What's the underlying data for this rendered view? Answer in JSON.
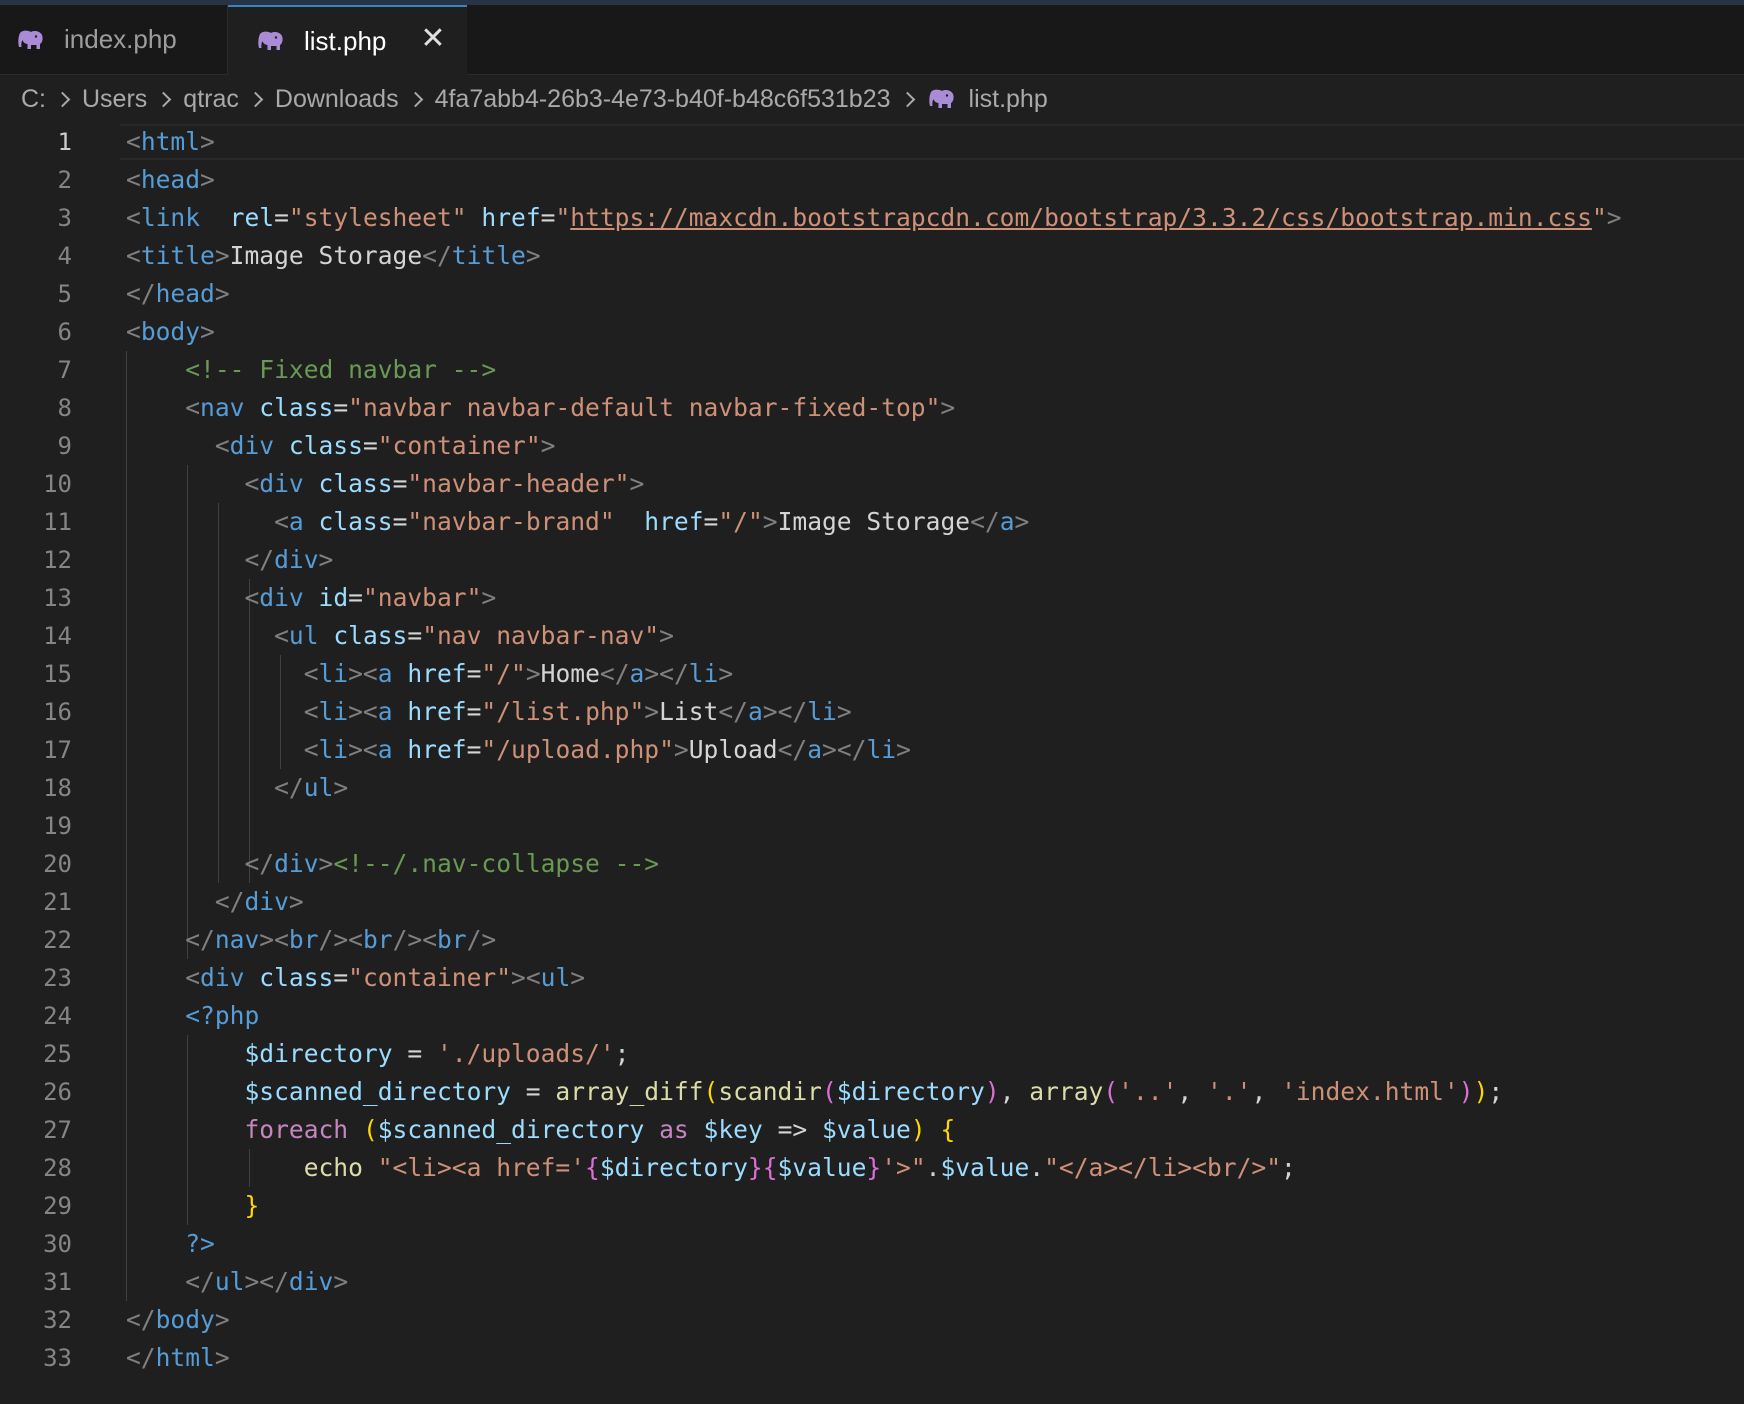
{
  "tabs": [
    {
      "label": "index.php",
      "icon": "php-elephant-icon"
    },
    {
      "label": "list.php",
      "icon": "php-elephant-icon",
      "close": "✕"
    }
  ],
  "breadcrumb": [
    "C:",
    "Users",
    "qtrac",
    "Downloads",
    "4fa7abb4-26b3-4e73-b40f-b48c6f531b23",
    "list.php"
  ],
  "active_line": 1,
  "colors": {
    "tag": "#569cd6",
    "attr": "#9cdcfe",
    "string": "#ce9178",
    "comment": "#6a9955",
    "function": "#dcdcaa",
    "keyword": "#c586c0",
    "php_icon": "#a98bd6"
  },
  "lines": [
    [
      [
        "p",
        "<"
      ],
      [
        "tg",
        "html"
      ],
      [
        "p",
        ">"
      ]
    ],
    [
      [
        "p",
        "<"
      ],
      [
        "tg",
        "head"
      ],
      [
        "p",
        ">"
      ]
    ],
    [
      [
        "p",
        "<"
      ],
      [
        "tg",
        "link"
      ],
      [
        "",
        "  "
      ],
      [
        "at",
        "rel"
      ],
      [
        "",
        "="
      ],
      [
        "s",
        "\"stylesheet\""
      ],
      [
        "",
        " "
      ],
      [
        "at",
        "href"
      ],
      [
        "",
        "="
      ],
      [
        "s",
        "\""
      ],
      [
        "s ul",
        "https://maxcdn.bootstrapcdn.com/bootstrap/3.3.2/css/bootstrap.min.css"
      ],
      [
        "s",
        "\""
      ],
      [
        "p",
        ">"
      ]
    ],
    [
      [
        "p",
        "<"
      ],
      [
        "tg",
        "title"
      ],
      [
        "p",
        ">"
      ],
      [
        "",
        "Image Storage"
      ],
      [
        "p",
        "</"
      ],
      [
        "tg",
        "title"
      ],
      [
        "p",
        ">"
      ]
    ],
    [
      [
        "p",
        "</"
      ],
      [
        "tg",
        "head"
      ],
      [
        "p",
        ">"
      ]
    ],
    [
      [
        "p",
        "<"
      ],
      [
        "tg",
        "body"
      ],
      [
        "p",
        ">"
      ]
    ],
    [
      [
        "",
        "    "
      ],
      [
        "cm",
        "<!-- Fixed navbar -->"
      ]
    ],
    [
      [
        "",
        "    "
      ],
      [
        "p",
        "<"
      ],
      [
        "tg",
        "nav"
      ],
      [
        "",
        " "
      ],
      [
        "at",
        "class"
      ],
      [
        "",
        "="
      ],
      [
        "s",
        "\"navbar navbar-default navbar-fixed-top\""
      ],
      [
        "p",
        ">"
      ]
    ],
    [
      [
        "",
        "      "
      ],
      [
        "p",
        "<"
      ],
      [
        "tg",
        "div"
      ],
      [
        "",
        " "
      ],
      [
        "at",
        "class"
      ],
      [
        "",
        "="
      ],
      [
        "s",
        "\"container\""
      ],
      [
        "p",
        ">"
      ]
    ],
    [
      [
        "",
        "        "
      ],
      [
        "p",
        "<"
      ],
      [
        "tg",
        "div"
      ],
      [
        "",
        " "
      ],
      [
        "at",
        "class"
      ],
      [
        "",
        "="
      ],
      [
        "s",
        "\"navbar-header\""
      ],
      [
        "p",
        ">"
      ]
    ],
    [
      [
        "",
        "          "
      ],
      [
        "p",
        "<"
      ],
      [
        "tg",
        "a"
      ],
      [
        "",
        " "
      ],
      [
        "at",
        "class"
      ],
      [
        "",
        "="
      ],
      [
        "s",
        "\"navbar-brand\""
      ],
      [
        "",
        "  "
      ],
      [
        "at",
        "href"
      ],
      [
        "",
        "="
      ],
      [
        "s",
        "\"/\""
      ],
      [
        "p",
        ">"
      ],
      [
        "",
        "Image Storage"
      ],
      [
        "p",
        "</"
      ],
      [
        "tg",
        "a"
      ],
      [
        "p",
        ">"
      ]
    ],
    [
      [
        "",
        "        "
      ],
      [
        "p",
        "</"
      ],
      [
        "tg",
        "div"
      ],
      [
        "p",
        ">"
      ]
    ],
    [
      [
        "",
        "        "
      ],
      [
        "p",
        "<"
      ],
      [
        "tg",
        "div"
      ],
      [
        "",
        " "
      ],
      [
        "at",
        "id"
      ],
      [
        "",
        "="
      ],
      [
        "s",
        "\"navbar\""
      ],
      [
        "p",
        ">"
      ]
    ],
    [
      [
        "",
        "          "
      ],
      [
        "p",
        "<"
      ],
      [
        "tg",
        "ul"
      ],
      [
        "",
        " "
      ],
      [
        "at",
        "class"
      ],
      [
        "",
        "="
      ],
      [
        "s",
        "\"nav navbar-nav\""
      ],
      [
        "p",
        ">"
      ]
    ],
    [
      [
        "",
        "            "
      ],
      [
        "p",
        "<"
      ],
      [
        "tg",
        "li"
      ],
      [
        "p",
        "><"
      ],
      [
        "tg",
        "a"
      ],
      [
        "",
        " "
      ],
      [
        "at",
        "href"
      ],
      [
        "",
        "="
      ],
      [
        "s",
        "\"/\""
      ],
      [
        "p",
        ">"
      ],
      [
        "",
        "Home"
      ],
      [
        "p",
        "</"
      ],
      [
        "tg",
        "a"
      ],
      [
        "p",
        "></"
      ],
      [
        "tg",
        "li"
      ],
      [
        "p",
        ">"
      ]
    ],
    [
      [
        "",
        "            "
      ],
      [
        "p",
        "<"
      ],
      [
        "tg",
        "li"
      ],
      [
        "p",
        "><"
      ],
      [
        "tg",
        "a"
      ],
      [
        "",
        " "
      ],
      [
        "at",
        "href"
      ],
      [
        "",
        "="
      ],
      [
        "s",
        "\"/list.php\""
      ],
      [
        "p",
        ">"
      ],
      [
        "",
        "List"
      ],
      [
        "p",
        "</"
      ],
      [
        "tg",
        "a"
      ],
      [
        "p",
        "></"
      ],
      [
        "tg",
        "li"
      ],
      [
        "p",
        ">"
      ]
    ],
    [
      [
        "",
        "            "
      ],
      [
        "p",
        "<"
      ],
      [
        "tg",
        "li"
      ],
      [
        "p",
        "><"
      ],
      [
        "tg",
        "a"
      ],
      [
        "",
        " "
      ],
      [
        "at",
        "href"
      ],
      [
        "",
        "="
      ],
      [
        "s",
        "\"/upload.php\""
      ],
      [
        "p",
        ">"
      ],
      [
        "",
        "Upload"
      ],
      [
        "p",
        "</"
      ],
      [
        "tg",
        "a"
      ],
      [
        "p",
        "></"
      ],
      [
        "tg",
        "li"
      ],
      [
        "p",
        ">"
      ]
    ],
    [
      [
        "",
        "          "
      ],
      [
        "p",
        "</"
      ],
      [
        "tg",
        "ul"
      ],
      [
        "p",
        ">"
      ]
    ],
    [],
    [
      [
        "",
        "        "
      ],
      [
        "p",
        "</"
      ],
      [
        "tg",
        "div"
      ],
      [
        "p",
        ">"
      ],
      [
        "cm",
        "<!--/.nav-collapse -->"
      ]
    ],
    [
      [
        "",
        "      "
      ],
      [
        "p",
        "</"
      ],
      [
        "tg",
        "div"
      ],
      [
        "p",
        ">"
      ]
    ],
    [
      [
        "",
        "    "
      ],
      [
        "p",
        "</"
      ],
      [
        "tg",
        "nav"
      ],
      [
        "p",
        "><"
      ],
      [
        "tg",
        "br"
      ],
      [
        "p",
        "/><"
      ],
      [
        "tg",
        "br"
      ],
      [
        "p",
        "/><"
      ],
      [
        "tg",
        "br"
      ],
      [
        "p",
        "/>"
      ]
    ],
    [
      [
        "",
        "    "
      ],
      [
        "p",
        "<"
      ],
      [
        "tg",
        "div"
      ],
      [
        "",
        " "
      ],
      [
        "at",
        "class"
      ],
      [
        "",
        "="
      ],
      [
        "s",
        "\"container\""
      ],
      [
        "p",
        "><"
      ],
      [
        "tg",
        "ul"
      ],
      [
        "p",
        ">"
      ]
    ],
    [
      [
        "",
        "    "
      ],
      [
        "tg",
        "<?php"
      ]
    ],
    [
      [
        "",
        "        "
      ],
      [
        "v",
        "$directory"
      ],
      [
        "",
        " = "
      ],
      [
        "s",
        "'./uploads/'"
      ],
      [
        "",
        ";"
      ]
    ],
    [
      [
        "",
        "        "
      ],
      [
        "v",
        "$scanned_directory"
      ],
      [
        "",
        " = "
      ],
      [
        "fn",
        "array_diff"
      ],
      [
        "b1",
        "("
      ],
      [
        "fn",
        "scandir"
      ],
      [
        "b2",
        "("
      ],
      [
        "v",
        "$directory"
      ],
      [
        "b2",
        ")"
      ],
      [
        "",
        ", "
      ],
      [
        "fn",
        "array"
      ],
      [
        "b2",
        "("
      ],
      [
        "s",
        "'..'"
      ],
      [
        "",
        ", "
      ],
      [
        "s",
        "'.'"
      ],
      [
        "",
        ", "
      ],
      [
        "s",
        "'index.html'"
      ],
      [
        "b2",
        ")"
      ],
      [
        "b1",
        ")"
      ],
      [
        "",
        ";"
      ]
    ],
    [
      [
        "",
        "        "
      ],
      [
        "kw",
        "foreach"
      ],
      [
        "",
        " "
      ],
      [
        "b1",
        "("
      ],
      [
        "v",
        "$scanned_directory"
      ],
      [
        "",
        " "
      ],
      [
        "kw",
        "as"
      ],
      [
        "",
        " "
      ],
      [
        "v",
        "$key"
      ],
      [
        "",
        " => "
      ],
      [
        "v",
        "$value"
      ],
      [
        "b1",
        ")"
      ],
      [
        "",
        " "
      ],
      [
        "b1",
        "{"
      ]
    ],
    [
      [
        "",
        "            "
      ],
      [
        "fn",
        "echo"
      ],
      [
        "",
        " "
      ],
      [
        "s",
        "\"<li><a href='"
      ],
      [
        "b2",
        "{"
      ],
      [
        "v",
        "$directory"
      ],
      [
        "b2",
        "}{"
      ],
      [
        "v",
        "$value"
      ],
      [
        "b2",
        "}"
      ],
      [
        "s",
        "'>\""
      ],
      [
        "",
        "."
      ],
      [
        "v",
        "$value"
      ],
      [
        "",
        "."
      ],
      [
        "s",
        "\"</a></li><br/>\""
      ],
      [
        "",
        ";"
      ]
    ],
    [
      [
        "",
        "        "
      ],
      [
        "b1",
        "}"
      ]
    ],
    [
      [
        "",
        "    "
      ],
      [
        "tg",
        "?>"
      ]
    ],
    [
      [
        "",
        "    "
      ],
      [
        "p",
        "</"
      ],
      [
        "tg",
        "ul"
      ],
      [
        "p",
        "></"
      ],
      [
        "tg",
        "div"
      ],
      [
        "p",
        ">"
      ]
    ],
    [
      [
        "p",
        "</"
      ],
      [
        "tg",
        "body"
      ],
      [
        "p",
        ">"
      ]
    ],
    [
      [
        "p",
        "</"
      ],
      [
        "tg",
        "html"
      ],
      [
        "p",
        ">"
      ]
    ]
  ]
}
